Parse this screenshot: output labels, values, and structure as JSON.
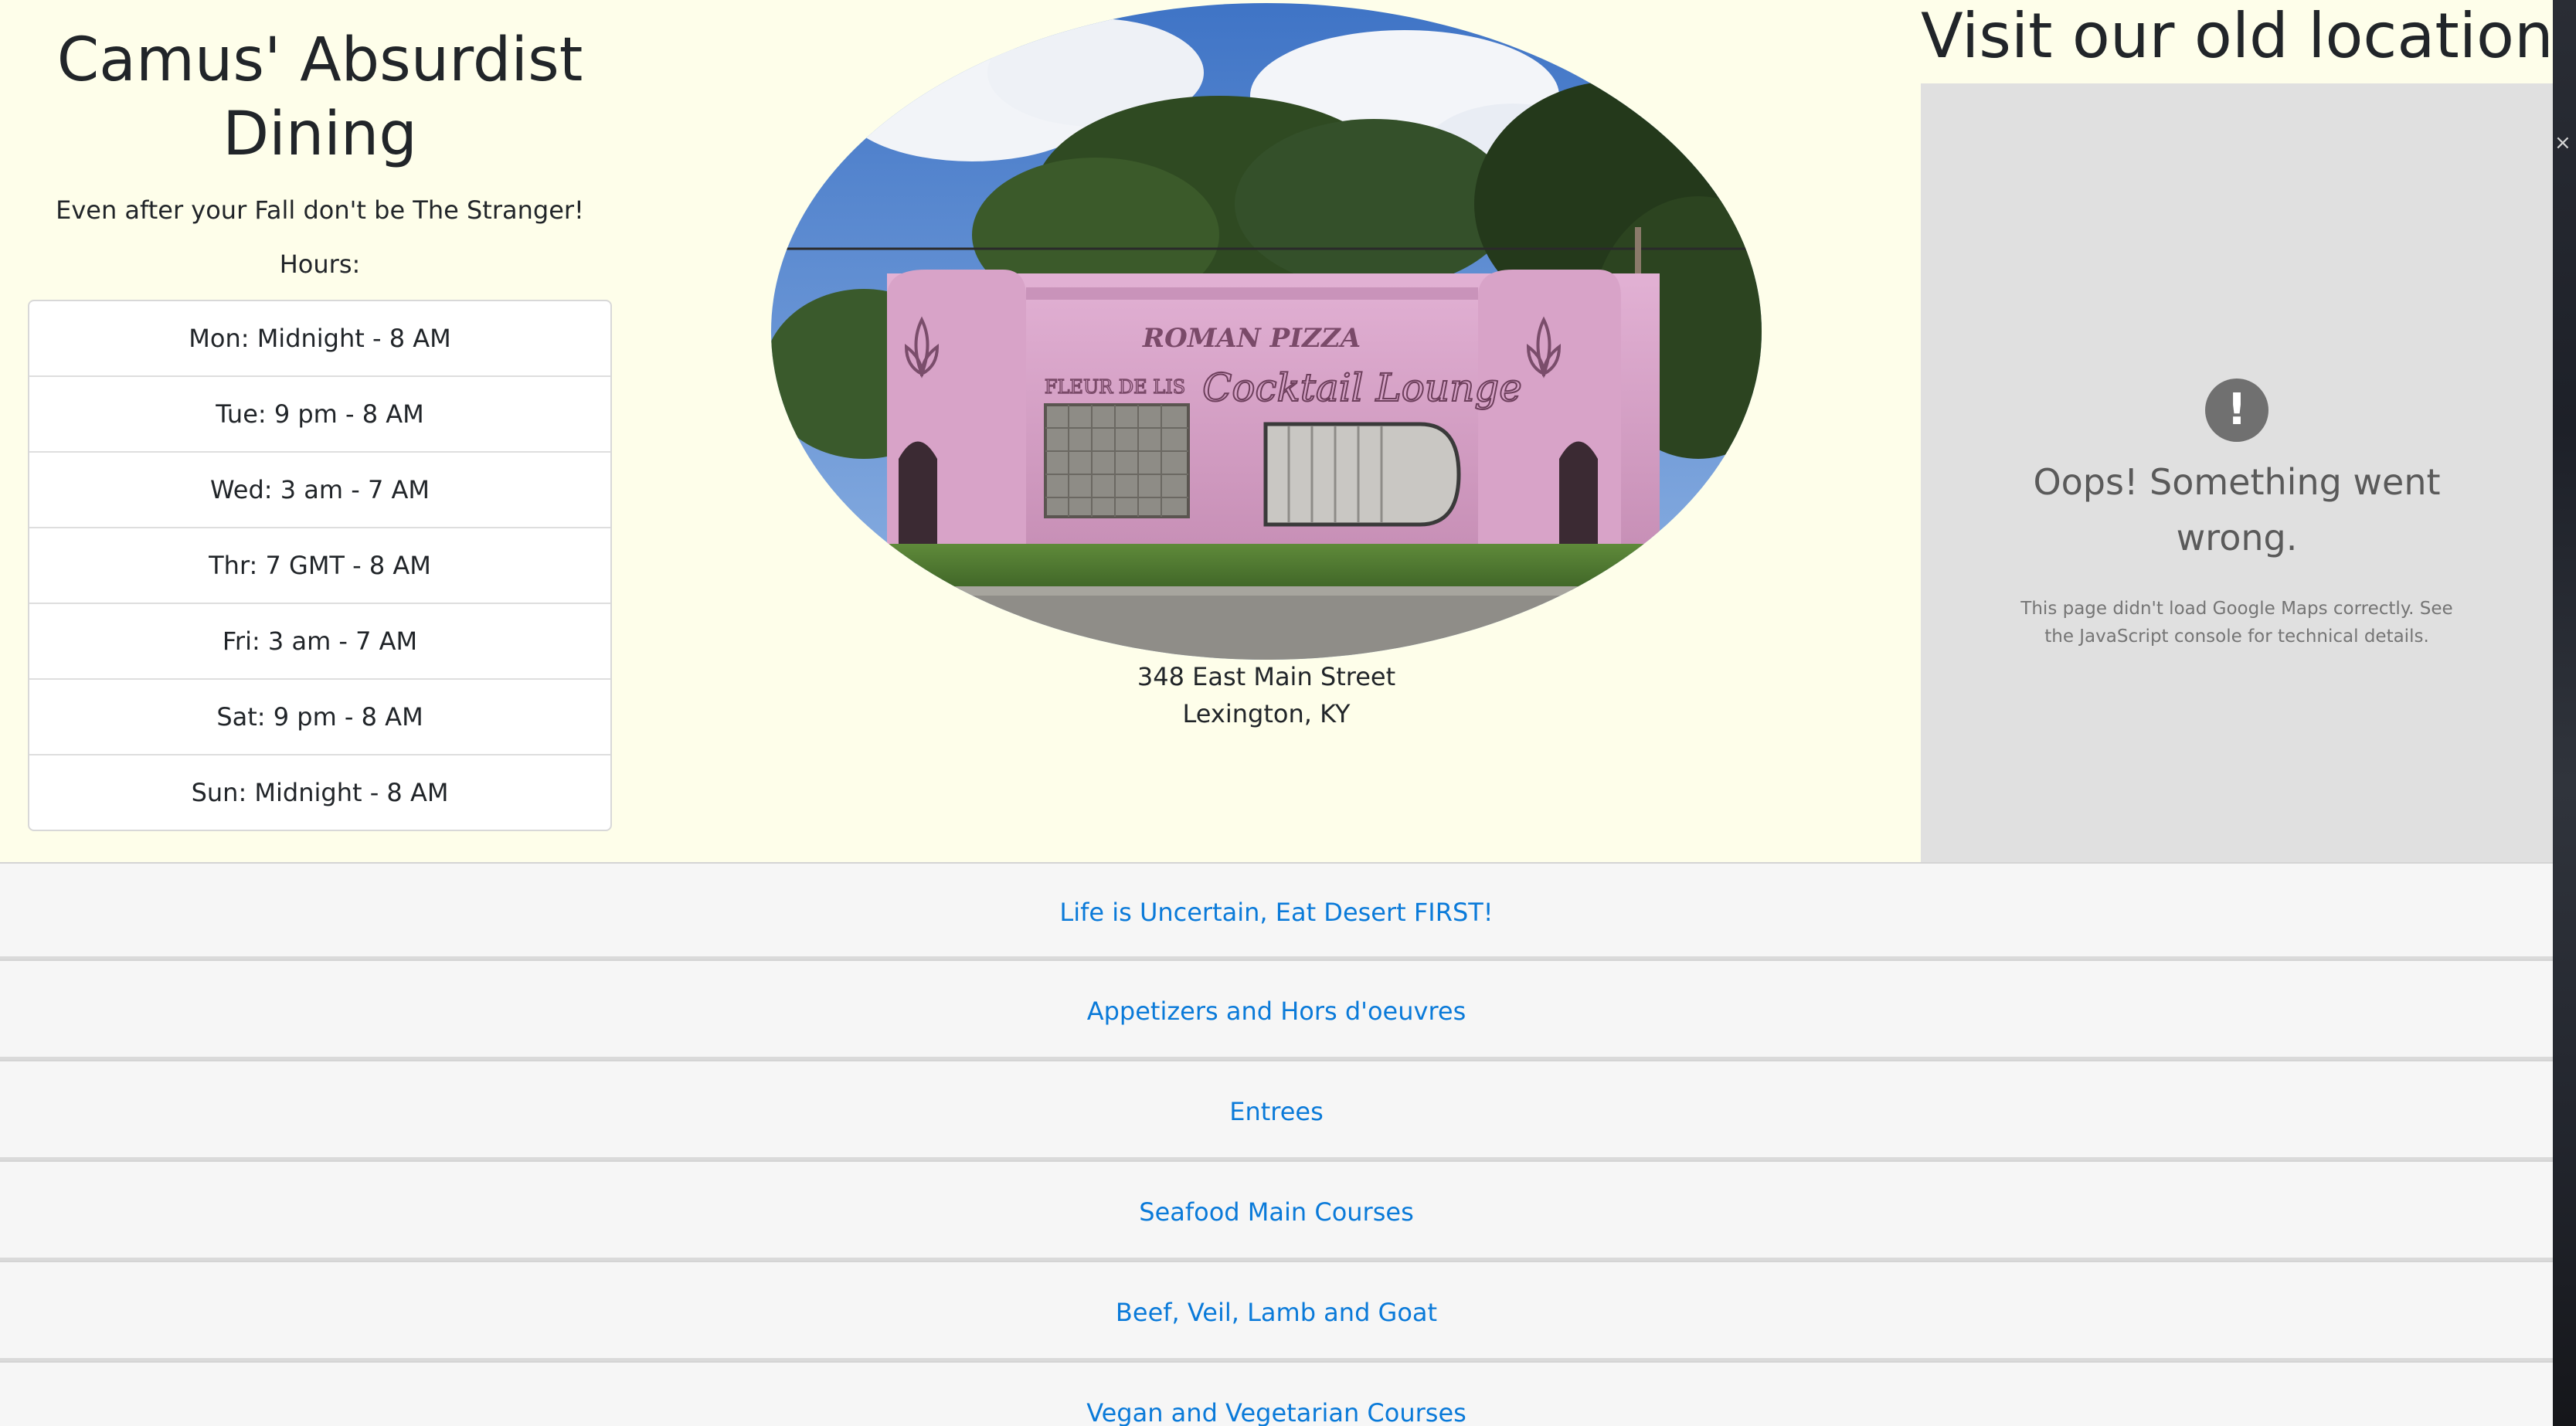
{
  "header": {
    "title": "Camus' Absurdist Dining",
    "tagline": "Even after your Fall don't be The Stranger!",
    "hours_label": "Hours:"
  },
  "hours": [
    "Mon: Midnight - 8 AM",
    "Tue: 9 pm - 8 AM",
    "Wed: 3 am - 7 AM",
    "Thr: 7 GMT - 8 AM",
    "Fri: 3 am - 7 AM",
    "Sat: 9 pm - 8 AM",
    "Sun: Midnight - 8 AM"
  ],
  "photo": {
    "sign_line1": "ROMAN PIZZA",
    "sign_line2": "Cocktail Lounge",
    "sign_side": "FLEUR DE LIS"
  },
  "address": {
    "street": "348 East Main Street",
    "city": "Lexington, KY"
  },
  "map": {
    "title": "Visit our old location!",
    "error_icon": "!",
    "error_title": "Oops! Something went wrong.",
    "error_detail": "This page didn't load Google Maps correctly. See the JavaScript console for technical details."
  },
  "menu": [
    "Life is Uncertain, Eat Desert FIRST!",
    "Appetizers and Hors d'oeuvres",
    "Entrees",
    "Seafood Main Courses",
    "Beef, Veil, Lamb and Goat",
    "Vegan and Vegetarian Courses"
  ],
  "colors": {
    "page_background": "#fefeea",
    "link": "#0a7ad9",
    "map_background": "#e0e0e0",
    "building_pink": "#d9a3c9"
  },
  "icons": {
    "map_error": "exclamation-circle-icon"
  }
}
